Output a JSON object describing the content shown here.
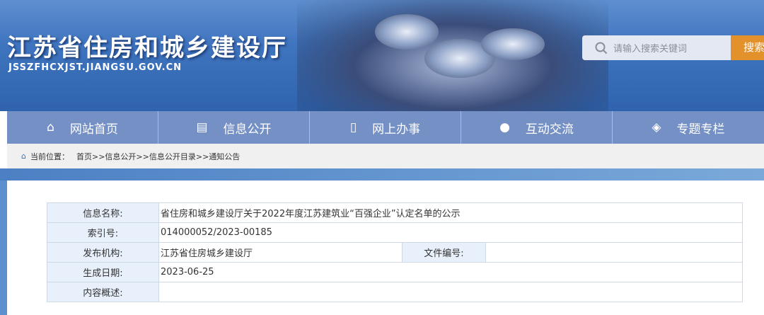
{
  "header": {
    "site_title": "江苏省住房和城乡建设厅",
    "domain": "JSSZFHCXJST.JIANGSU.GOV.CN",
    "search_placeholder": "请输入搜索关键词",
    "search_button": "搜索"
  },
  "nav": [
    {
      "label": "网站首页",
      "icon": "home-icon"
    },
    {
      "label": "信息公开",
      "icon": "document-icon"
    },
    {
      "label": "网上办事",
      "icon": "search-doc-icon"
    },
    {
      "label": "互动交流",
      "icon": "chat-icon"
    },
    {
      "label": "专题专栏",
      "icon": "layers-icon"
    }
  ],
  "breadcrumb": {
    "label": "当前位置：",
    "path": "首页>>信息公开>>信息公开目录>>通知公告"
  },
  "info": {
    "name_label": "信息名称:",
    "name": "省住房和城乡建设厅关于2022年度江苏建筑业“百强企业”认定名单的公示",
    "index_label": "索引号:",
    "index": "014000052/2023-00185",
    "org_label": "发布机构:",
    "org": "江苏省住房城乡建设厅",
    "docno_label": "文件编号:",
    "docno": "",
    "date_label": "生成日期:",
    "date": "2023-06-25",
    "summary_label": "内容概述:",
    "summary": ""
  },
  "colors": {
    "nav": "#7590c4",
    "search_button": "#e3912b",
    "label_bg": "#e8f1fb"
  }
}
